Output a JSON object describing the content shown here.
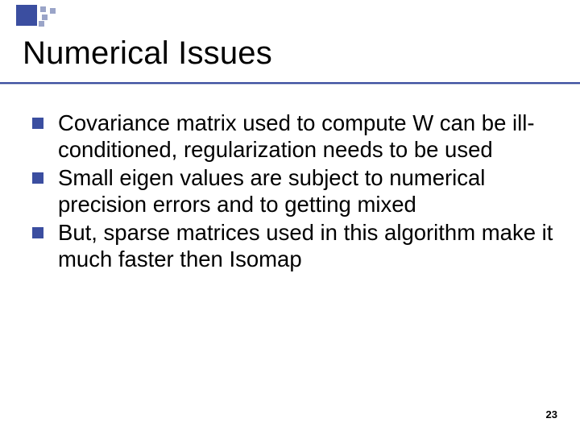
{
  "title": "Numerical Issues",
  "bullets": [
    "Covariance matrix used to compute W can be ill-conditioned, regularization needs to be used",
    "Small eigen values are subject to numerical precision errors and to getting mixed",
    "But, sparse matrices used in this algorithm make it much faster then Isomap"
  ],
  "page_number": "23"
}
